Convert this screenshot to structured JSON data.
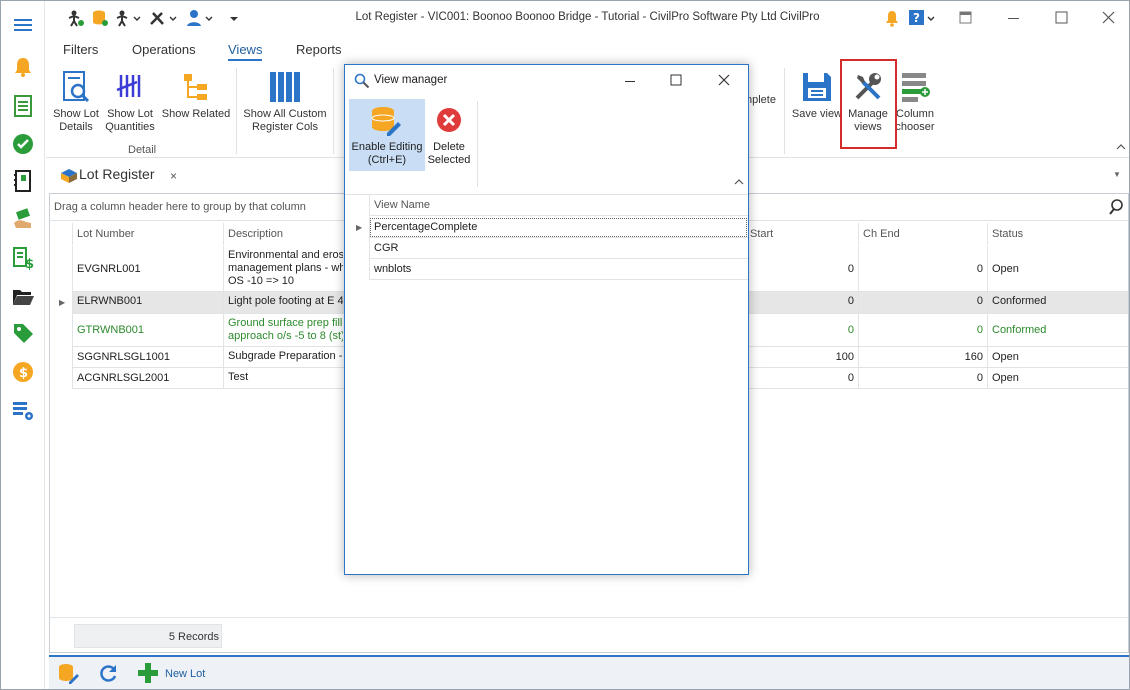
{
  "window": {
    "title": "Lot Register - VIC001: Boonoo Boonoo Bridge - Tutorial - CivilPro Software Pty Ltd CivilPro"
  },
  "left_nav": {
    "icons": [
      "hamburger-icon",
      "bell-icon",
      "checklist-icon",
      "check-circle-icon",
      "book-icon",
      "hand-money-icon",
      "invoice-dollar-icon",
      "folder-open-icon",
      "tag-icon",
      "coin-dollar-icon",
      "list-settings-icon"
    ]
  },
  "menu": {
    "tabs": [
      "Filters",
      "Operations",
      "Views",
      "Reports"
    ],
    "active": "Views"
  },
  "ribbon": {
    "show_lot_details": "Show Lot\nDetails",
    "show_lot_quantities": "Show Lot\nQuantities",
    "show_related": "Show Related",
    "show_all_custom": "Show All Custom\nRegister Cols",
    "group_detail": "Detail",
    "partial_complete": "nplete",
    "save_view": "Save view",
    "manage_views": "Manage\nviews",
    "column_chooser": "Column\nchooser"
  },
  "doc_tab": {
    "title": "Lot Register",
    "close": "×"
  },
  "grid": {
    "group_hint": "Drag a column header here to group by that column",
    "columns": {
      "lot_number": "Lot Number",
      "description": "Description",
      "ch_start": "Start",
      "ch_end": "Ch End",
      "status": "Status"
    },
    "rows": [
      {
        "lot": "EVGNRL001",
        "desc": "Environmental and erosio\nmanagement plans - who\nOS -10 => 10",
        "start": "0",
        "end": "0",
        "status": "Open"
      },
      {
        "lot": "ELRWNB001",
        "desc": "Light pole footing at E 4(",
        "start": "0",
        "end": "0",
        "status": "Conformed"
      },
      {
        "lot": "GTRWNB001",
        "desc": "Ground surface prep fill\napproach o/s -5 to 8 (st)",
        "start": "0",
        "end": "0",
        "status": "Conformed"
      },
      {
        "lot": "SGGNRLSGL1001",
        "desc": "Subgrade Preparation - (",
        "start": "100",
        "end": "160",
        "status": "Open"
      },
      {
        "lot": "ACGNRLSGL2001",
        "desc": "Test",
        "start": "0",
        "end": "0",
        "status": "Open"
      }
    ],
    "records": "5 Records"
  },
  "bottom_bar": {
    "new_lot": "New Lot"
  },
  "dialog": {
    "title": "View manager",
    "enable_editing": "Enable Editing\n(Ctrl+E)",
    "delete_selected": "Delete\nSelected",
    "column_header": "View Name",
    "views": [
      "PercentageComplete",
      "CGR",
      "wnblots"
    ]
  },
  "colors": {
    "accent": "#2b74c7",
    "highlight_red": "#d42b2b",
    "conformed_green": "#2c8a2c"
  }
}
